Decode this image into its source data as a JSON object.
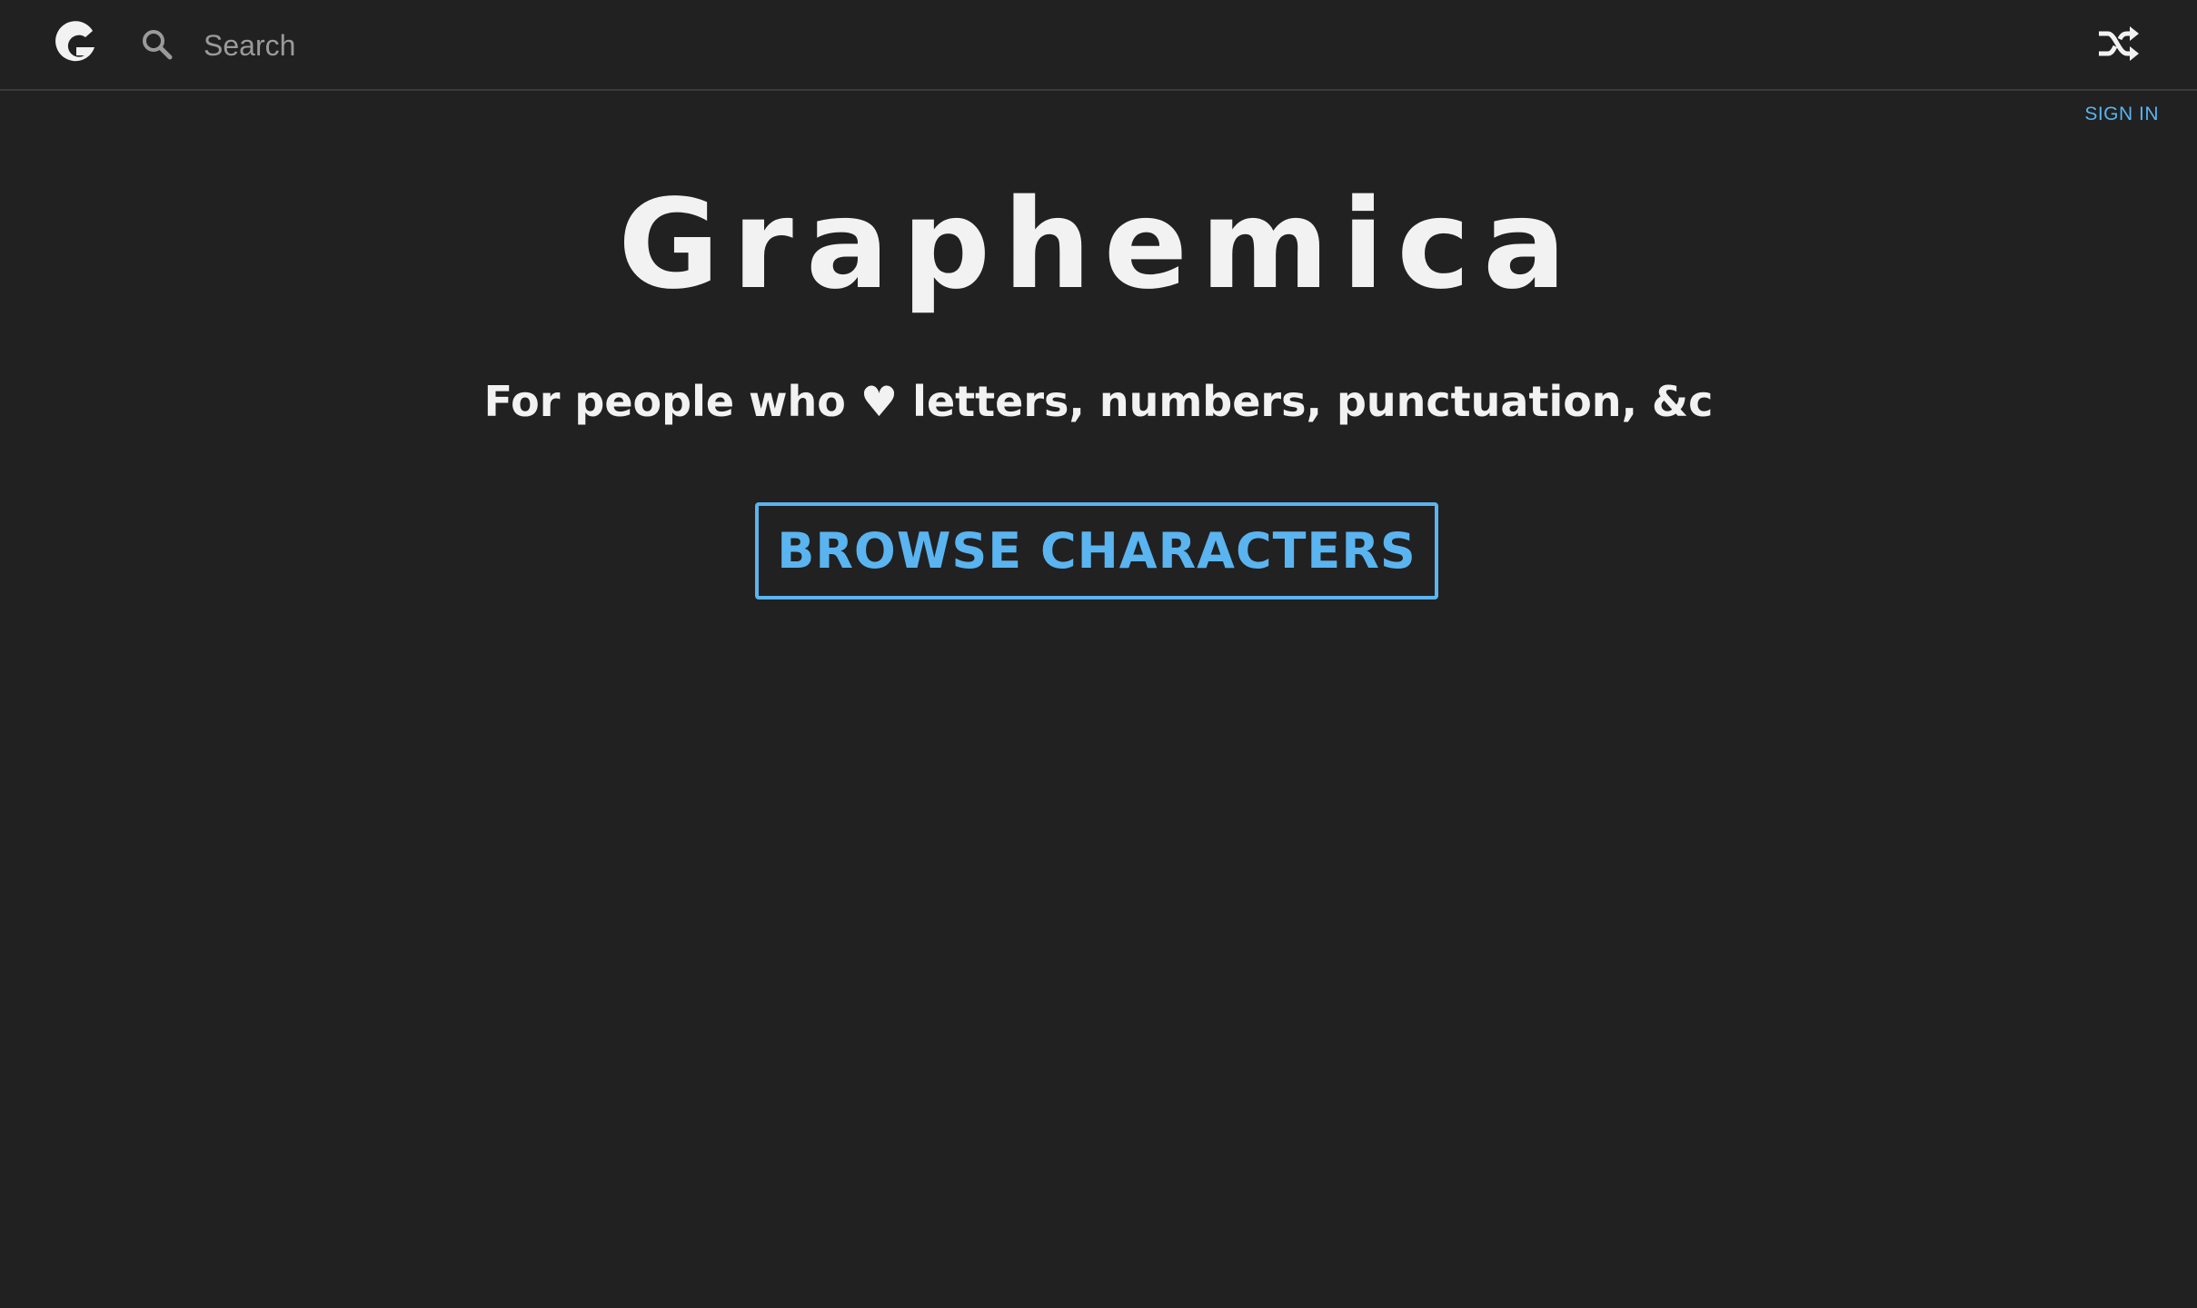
{
  "header": {
    "logo_icon": "graphemica-g-logo",
    "search": {
      "icon": "search-icon",
      "placeholder": "Search",
      "value": ""
    },
    "shuffle_icon": "shuffle-icon",
    "sign_in_label": "SIGN IN"
  },
  "hero": {
    "title": "Graphemica",
    "tagline": "For people who ♥ letters, numbers, punctuation, &c",
    "browse_label": "BROWSE CHARACTERS"
  },
  "colors": {
    "background": "#212121",
    "text": "#f2f2f2",
    "accent": "#5ab4f0",
    "divider": "#3a3a3a"
  }
}
